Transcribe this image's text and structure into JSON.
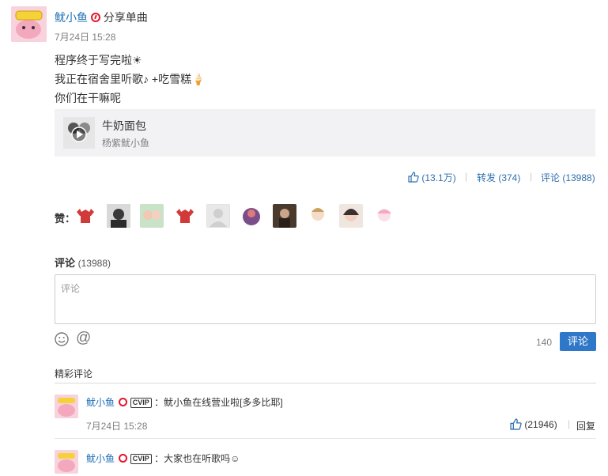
{
  "post": {
    "author": "鱿小鱼",
    "action_text": "分享单曲",
    "time": "7月24日 15:28",
    "lines": [
      "程序终于写完啦☀",
      "我正在宿舍里听歌♪ +吃雪糕🍦",
      "你们在干嘛呢"
    ]
  },
  "music_card": {
    "title": "牛奶面包",
    "artist": "杨紫鱿小鱼"
  },
  "actions": {
    "like_label": "(13.1万)",
    "repost_label": "转发 (374)",
    "comment_label": "评论 (13988)"
  },
  "likes": {
    "label": "赞："
  },
  "comment_section": {
    "title": "评论",
    "count": "(13988)",
    "placeholder": "评论",
    "char_count": "140",
    "submit_label": "评论",
    "hot_title": "精彩评论"
  },
  "comments": [
    {
      "author": "鱿小鱼",
      "vip": "CVIP",
      "text": "：鱿小鱼在线营业啦[多多比耶]",
      "time": "7月24日 15:28",
      "likes": "(21946)",
      "reply": "回复"
    },
    {
      "author": "鱿小鱼",
      "vip": "CVIP",
      "text": "：大家也在听歌吗☺"
    }
  ],
  "colors": {
    "accent_blue": "#1c6fb5",
    "button_blue": "#2f78c9",
    "card_bg": "#f2f2f5",
    "verified_red": "#e6162d"
  }
}
